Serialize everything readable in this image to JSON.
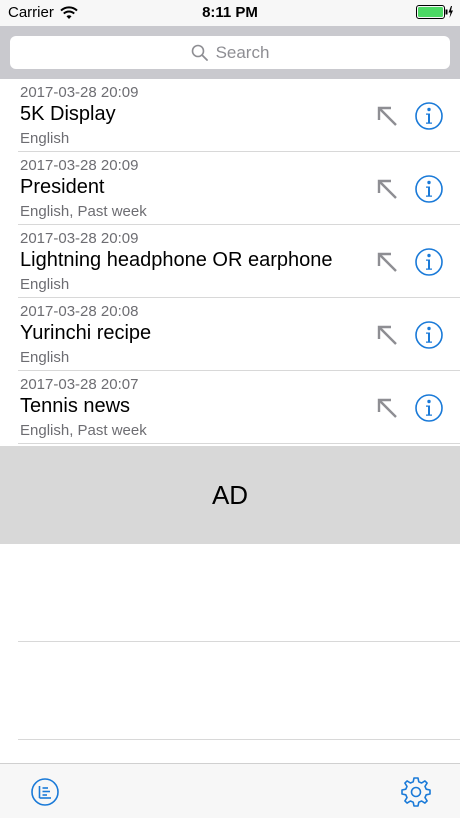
{
  "status_bar": {
    "carrier": "Carrier",
    "time": "8:11 PM"
  },
  "search": {
    "placeholder": "Search"
  },
  "history": [
    {
      "timestamp": "2017-03-28 20:09",
      "query": "5K Display",
      "options": "English"
    },
    {
      "timestamp": "2017-03-28 20:09",
      "query": "President",
      "options": "English, Past week"
    },
    {
      "timestamp": "2017-03-28 20:09",
      "query": "Lightning headphone OR earphone",
      "options": "English"
    },
    {
      "timestamp": "2017-03-28 20:08",
      "query": "Yurinchi recipe",
      "options": "English"
    },
    {
      "timestamp": "2017-03-28 20:07",
      "query": "Tennis news",
      "options": "English, Past week"
    }
  ],
  "ad": {
    "label": "AD"
  },
  "colors": {
    "accent": "#1a7ad8",
    "battery": "#4cd964",
    "secondary_text": "#6d6d72",
    "ad_background": "#d8d8d8"
  },
  "icons": {
    "wifi": "wifi-icon",
    "battery": "battery-icon",
    "search": "search-icon",
    "fill_query": "arrow-up-left-icon",
    "info": "info-icon",
    "list": "list-icon",
    "settings": "gear-icon"
  }
}
